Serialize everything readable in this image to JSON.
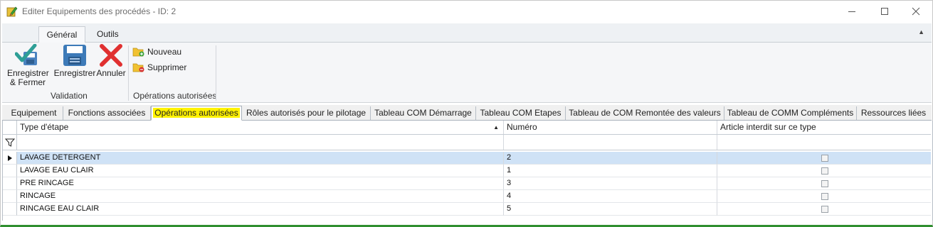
{
  "window": {
    "title": "Editer Equipements des procédés - ID: 2"
  },
  "ribbon": {
    "tabs": [
      "Général",
      "Outils"
    ],
    "buttons": {
      "save_close": "Enregistrer & Fermer",
      "save": "Enregistrer",
      "cancel": "Annuler",
      "new": "Nouveau",
      "delete": "Supprimer"
    },
    "groups": {
      "validation": "Validation",
      "operations": "Opérations autorisées"
    }
  },
  "page_tabs": [
    "Equipement",
    "Fonctions associées",
    "Opérations autorisées",
    "Rôles autorisés pour le pilotage",
    "Tableau COM Démarrage",
    "Tableau COM Etapes",
    "Tableau de COM Remontée des valeurs",
    "Tableau de COMM Compléments",
    "Ressources liées"
  ],
  "grid": {
    "columns": [
      "Type d'étape",
      "Numéro",
      "Article interdit sur ce type"
    ],
    "rows": [
      {
        "type": "LAVAGE DETERGENT",
        "numero": "2",
        "interdit": false
      },
      {
        "type": "LAVAGE EAU CLAIR",
        "numero": "1",
        "interdit": false
      },
      {
        "type": "PRE RINCAGE",
        "numero": "3",
        "interdit": false
      },
      {
        "type": "RINCAGE",
        "numero": "4",
        "interdit": false
      },
      {
        "type": "RINCAGE EAU CLAIR",
        "numero": "5",
        "interdit": false
      }
    ]
  },
  "colors": {
    "selected_row": "#cfe2f6",
    "active_tab_highlight": "#fff200",
    "save_icon": "#3d7ab8",
    "cancel_icon": "#e03030",
    "check_icon": "#2e9e96"
  },
  "icons": [
    "pencil-app-icon",
    "minimize-icon",
    "maximize-icon",
    "close-icon",
    "check-save-icon",
    "floppy-disk-icon",
    "red-x-icon",
    "folder-add-icon",
    "folder-delete-icon",
    "filter-icon",
    "sort-ascending-icon",
    "row-pointer-icon"
  ]
}
